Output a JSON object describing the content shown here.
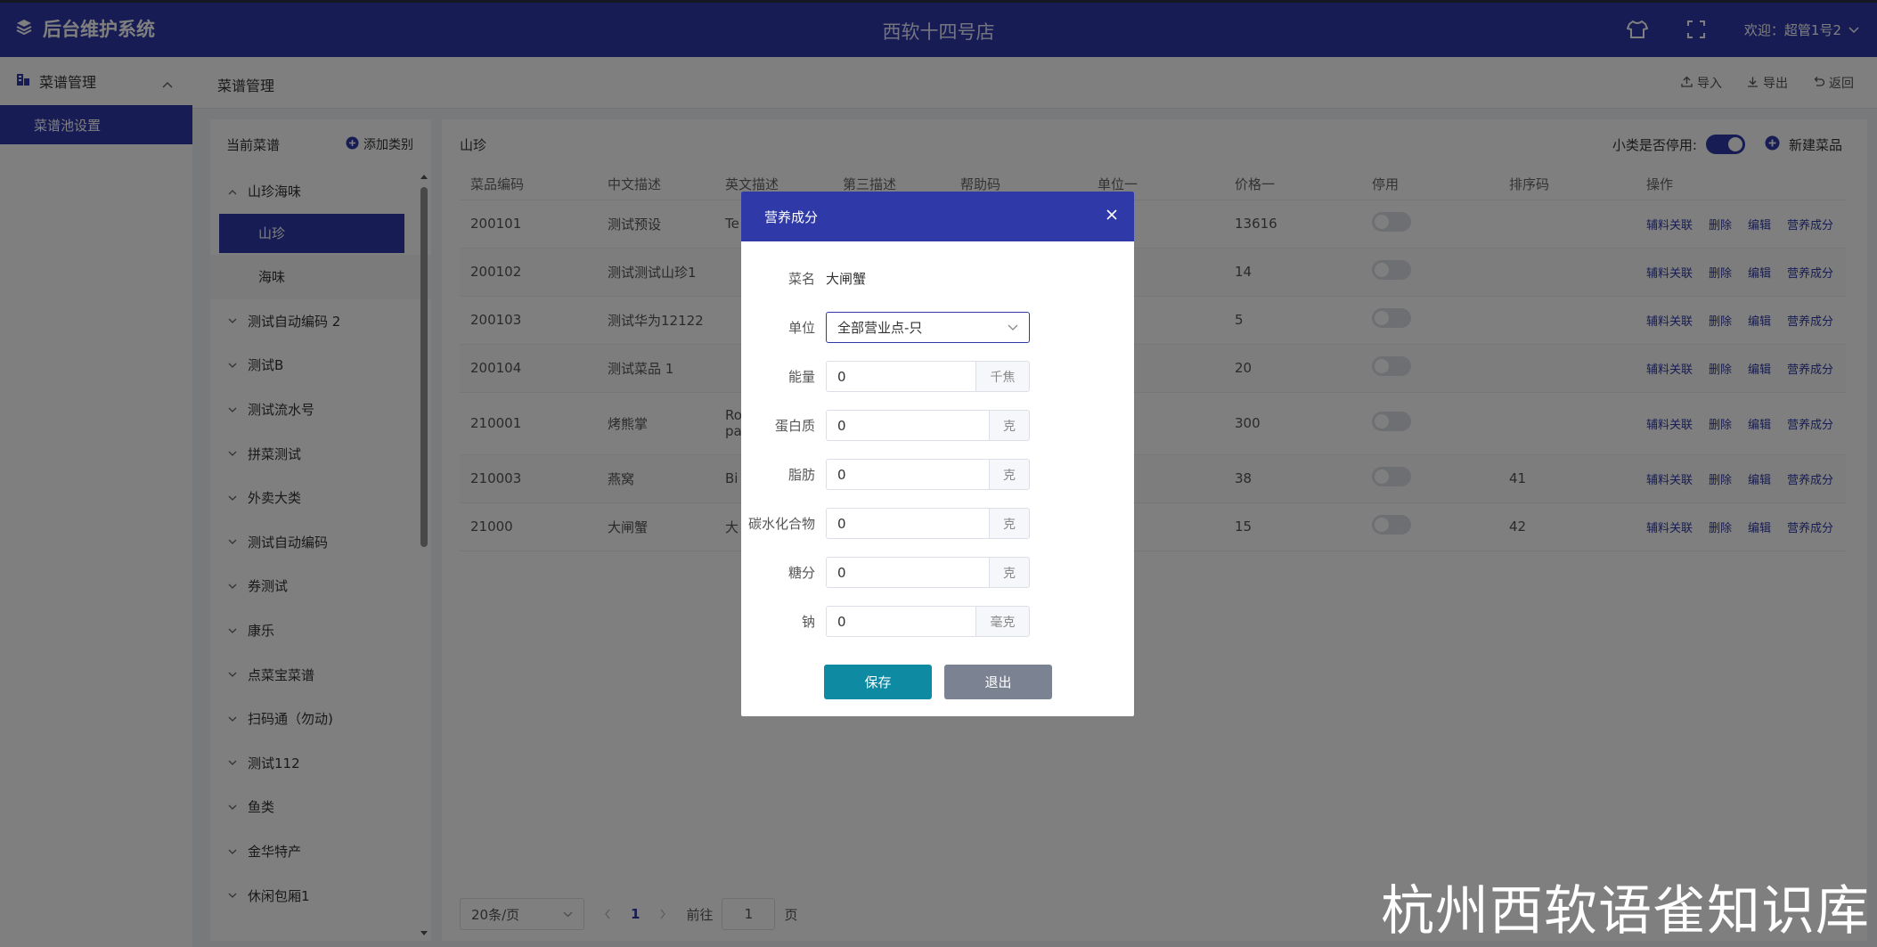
{
  "header": {
    "brand": "后台维护系统",
    "store": "西软十四号店",
    "welcome": "欢迎：超管1号2"
  },
  "sidebar": {
    "group_label": "菜谱管理",
    "active_item": "菜谱池设置"
  },
  "subheader": {
    "title": "菜谱管理",
    "import_label": "导入",
    "export_label": "导出",
    "back_label": "返回"
  },
  "left_panel": {
    "title": "当前菜谱",
    "add_label": "添加类别",
    "expanded_category": "山珍海味",
    "sub_items": [
      "山珍",
      "海味"
    ],
    "categories": [
      "测试自动编码 2",
      "测试B",
      "测试流水号",
      "拼菜测试",
      "外卖大类",
      "测试自动编码",
      "券测试",
      "康乐",
      "点菜宝菜谱",
      "扫码通（勿动)",
      "测试112",
      "鱼类",
      "金华特产",
      "休闲包厢1"
    ]
  },
  "main_panel": {
    "title": "山珍",
    "toggle_label": "小类是否停用:",
    "toggle_on": true,
    "new_label": "新建菜品",
    "columns": [
      "菜品编码",
      "中文描述",
      "英文描述",
      "第三描述",
      "帮助码",
      "单位一",
      "价格一",
      "停用",
      "排序码",
      "操作"
    ],
    "rows": [
      {
        "code": "200101",
        "cn": "测试预设",
        "en": "Te",
        "price": "13616",
        "sort": ""
      },
      {
        "code": "200102",
        "cn": "测试测试山珍1",
        "en": "",
        "price": "14",
        "sort": ""
      },
      {
        "code": "200103",
        "cn": "测试华为12122",
        "en": "",
        "price": "5",
        "sort": ""
      },
      {
        "code": "200104",
        "cn": "测试菜品 1",
        "en": "",
        "price": "20",
        "sort": ""
      },
      {
        "code": "210001",
        "cn": "烤熊掌",
        "en": "Ro",
        "en2": "pa",
        "price": "300",
        "sort": ""
      },
      {
        "code": "210003",
        "cn": "燕窝",
        "en": "Bi",
        "price": "38",
        "sort": "41"
      },
      {
        "code": "21000",
        "cn": "大闸蟹",
        "en": "大",
        "price": "15",
        "sort": "42"
      }
    ],
    "ops": [
      "辅料关联",
      "删除",
      "编辑",
      "营养成分"
    ],
    "pager": {
      "size": "20条/页",
      "current": "1",
      "goto": "前往",
      "page_value": "1",
      "page_unit": "页"
    }
  },
  "dialog": {
    "title": "营养成分",
    "dish_label": "菜名",
    "dish_value": "大闸蟹",
    "unit_label": "单位",
    "unit_value": "全部营业点-只",
    "fields": [
      {
        "label": "能量",
        "value": "0",
        "unit": "千焦"
      },
      {
        "label": "蛋白质",
        "value": "0",
        "unit": "克"
      },
      {
        "label": "脂肪",
        "value": "0",
        "unit": "克"
      },
      {
        "label": "碳水化合物",
        "value": "0",
        "unit": "克"
      },
      {
        "label": "糖分",
        "value": "0",
        "unit": "克"
      },
      {
        "label": "钠",
        "value": "0",
        "unit": "毫克"
      }
    ],
    "save_label": "保存",
    "exit_label": "退出"
  },
  "watermark": "杭州西软语雀知识库",
  "colors": {
    "primary": "#2f3aa8",
    "save": "#0e8aa3",
    "exit": "#7b8393"
  }
}
